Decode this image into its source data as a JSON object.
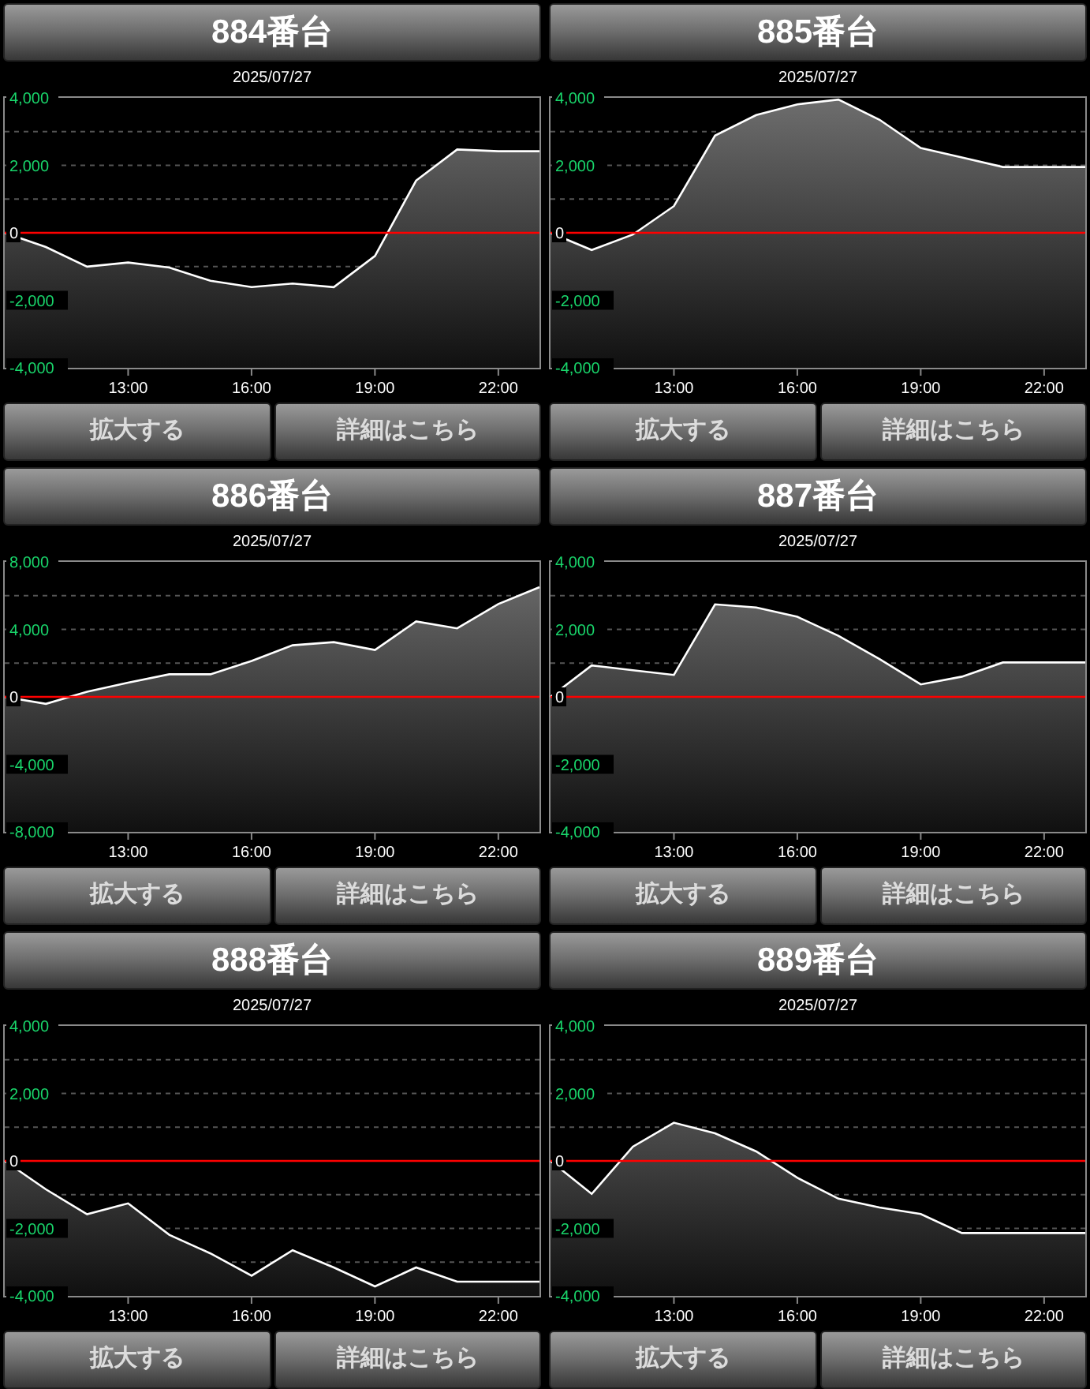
{
  "panels": [
    {
      "title": "884番台",
      "buttons": [
        "拡大する",
        "詳細はこちら"
      ],
      "chart_data": {
        "type": "line",
        "title": "2025/07/27",
        "x": [
          10,
          11,
          12,
          13,
          14,
          15,
          16,
          17,
          18,
          19,
          20,
          21,
          22,
          23
        ],
        "xlim": [
          10,
          23
        ],
        "ylim": [
          -4000,
          4000
        ],
        "xticks": [
          {
            "value": 13,
            "label": "13:00"
          },
          {
            "value": 16,
            "label": "16:00"
          },
          {
            "value": 19,
            "label": "19:00"
          },
          {
            "value": 22,
            "label": "22:00"
          }
        ],
        "yticks": [
          {
            "value": 4000,
            "label": "4,000"
          },
          {
            "value": 2000,
            "label": "2,000"
          },
          {
            "value": 0,
            "label": "0"
          },
          {
            "value": -2000,
            "label": "-2,000"
          },
          {
            "value": -4000,
            "label": "-4,000"
          }
        ],
        "series": [
          {
            "color": "#ffffff",
            "values": [
              0,
              -420,
              -1000,
              -880,
              -1030,
              -1420,
              -1610,
              -1500,
              -1610,
              -690,
              1550,
              2470,
              2420,
              2420
            ]
          }
        ],
        "ref_lines": [
          {
            "axis": "y",
            "value": 0
          }
        ]
      }
    },
    {
      "title": "885番台",
      "buttons": [
        "拡大する",
        "詳細はこちら"
      ],
      "chart_data": {
        "type": "line",
        "title": "2025/07/27",
        "x": [
          10,
          11,
          12,
          13,
          14,
          15,
          16,
          17,
          18,
          19,
          20,
          21,
          22,
          23
        ],
        "xlim": [
          10,
          23
        ],
        "ylim": [
          -4000,
          4000
        ],
        "xticks": [
          {
            "value": 13,
            "label": "13:00"
          },
          {
            "value": 16,
            "label": "16:00"
          },
          {
            "value": 19,
            "label": "19:00"
          },
          {
            "value": 22,
            "label": "22:00"
          }
        ],
        "yticks": [
          {
            "value": 4000,
            "label": "4,000"
          },
          {
            "value": 2000,
            "label": "2,000"
          },
          {
            "value": 0,
            "label": "0"
          },
          {
            "value": -2000,
            "label": "-2,000"
          },
          {
            "value": -4000,
            "label": "-4,000"
          }
        ],
        "series": [
          {
            "color": "#ffffff",
            "values": [
              0,
              -510,
              -50,
              790,
              2880,
              3490,
              3810,
              3950,
              3350,
              2510,
              2230,
              1950,
              1950,
              1950
            ]
          }
        ],
        "ref_lines": [
          {
            "axis": "y",
            "value": 0
          }
        ]
      }
    },
    {
      "title": "886番台",
      "buttons": [
        "拡大する",
        "詳細はこちら"
      ],
      "chart_data": {
        "type": "line",
        "title": "2025/07/27",
        "x": [
          10,
          11,
          12,
          13,
          14,
          15,
          16,
          17,
          18,
          19,
          20,
          21,
          22,
          23
        ],
        "xlim": [
          10,
          23
        ],
        "ylim": [
          -8000,
          8000
        ],
        "xticks": [
          {
            "value": 13,
            "label": "13:00"
          },
          {
            "value": 16,
            "label": "16:00"
          },
          {
            "value": 19,
            "label": "19:00"
          },
          {
            "value": 22,
            "label": "22:00"
          }
        ],
        "yticks": [
          {
            "value": 8000,
            "label": "8,000"
          },
          {
            "value": 4000,
            "label": "4,000"
          },
          {
            "value": 0,
            "label": "0"
          },
          {
            "value": -4000,
            "label": "-4,000"
          },
          {
            "value": -8000,
            "label": "-8,000"
          }
        ],
        "series": [
          {
            "color": "#ffffff",
            "values": [
              0,
              -410,
              310,
              840,
              1340,
              1340,
              2130,
              3060,
              3250,
              2780,
              4470,
              4060,
              5500,
              6500
            ]
          }
        ],
        "ref_lines": [
          {
            "axis": "y",
            "value": 0
          }
        ]
      }
    },
    {
      "title": "887番台",
      "buttons": [
        "拡大する",
        "詳細はこちら"
      ],
      "chart_data": {
        "type": "line",
        "title": "2025/07/27",
        "x": [
          10,
          11,
          12,
          13,
          14,
          15,
          16,
          17,
          18,
          19,
          20,
          21,
          22,
          23
        ],
        "xlim": [
          10,
          23
        ],
        "ylim": [
          -4000,
          4000
        ],
        "xticks": [
          {
            "value": 13,
            "label": "13:00"
          },
          {
            "value": 16,
            "label": "16:00"
          },
          {
            "value": 19,
            "label": "19:00"
          },
          {
            "value": 22,
            "label": "22:00"
          }
        ],
        "yticks": [
          {
            "value": 4000,
            "label": "4,000"
          },
          {
            "value": 2000,
            "label": "2,000"
          },
          {
            "value": 0,
            "label": "0"
          },
          {
            "value": -2000,
            "label": "-2,000"
          },
          {
            "value": -4000,
            "label": "-4,000"
          }
        ],
        "series": [
          {
            "color": "#ffffff",
            "values": [
              0,
              930,
              790,
              650,
              2740,
              2650,
              2370,
              1810,
              1120,
              370,
              600,
              1020,
              1020,
              1020
            ]
          }
        ],
        "ref_lines": [
          {
            "axis": "y",
            "value": 0
          }
        ]
      }
    },
    {
      "title": "888番台",
      "buttons": [
        "拡大する",
        "詳細はこちら"
      ],
      "chart_data": {
        "type": "line",
        "title": "2025/07/27",
        "x": [
          10,
          11,
          12,
          13,
          14,
          15,
          16,
          17,
          18,
          19,
          20,
          21,
          22,
          23
        ],
        "xlim": [
          10,
          23
        ],
        "ylim": [
          -4000,
          4000
        ],
        "xticks": [
          {
            "value": 13,
            "label": "13:00"
          },
          {
            "value": 16,
            "label": "16:00"
          },
          {
            "value": 19,
            "label": "19:00"
          },
          {
            "value": 22,
            "label": "22:00"
          }
        ],
        "yticks": [
          {
            "value": 4000,
            "label": "4,000"
          },
          {
            "value": 2000,
            "label": "2,000"
          },
          {
            "value": 0,
            "label": "0"
          },
          {
            "value": -2000,
            "label": "-2,000"
          },
          {
            "value": -4000,
            "label": "-4,000"
          }
        ],
        "series": [
          {
            "color": "#ffffff",
            "values": [
              0,
              -840,
              -1580,
              -1260,
              -2190,
              -2740,
              -3400,
              -2650,
              -3160,
              -3720,
              -3160,
              -3580,
              -3580,
              -3580
            ]
          }
        ],
        "ref_lines": [
          {
            "axis": "y",
            "value": 0
          }
        ]
      }
    },
    {
      "title": "889番台",
      "buttons": [
        "拡大する",
        "詳細はこちら"
      ],
      "chart_data": {
        "type": "line",
        "title": "2025/07/27",
        "x": [
          10,
          11,
          12,
          13,
          14,
          15,
          16,
          17,
          18,
          19,
          20,
          21,
          22,
          23
        ],
        "xlim": [
          10,
          23
        ],
        "ylim": [
          -4000,
          4000
        ],
        "xticks": [
          {
            "value": 13,
            "label": "13:00"
          },
          {
            "value": 16,
            "label": "16:00"
          },
          {
            "value": 19,
            "label": "19:00"
          },
          {
            "value": 22,
            "label": "22:00"
          }
        ],
        "yticks": [
          {
            "value": 4000,
            "label": "4,000"
          },
          {
            "value": 2000,
            "label": "2,000"
          },
          {
            "value": 0,
            "label": "0"
          },
          {
            "value": -2000,
            "label": "-2,000"
          },
          {
            "value": -4000,
            "label": "-4,000"
          }
        ],
        "series": [
          {
            "color": "#ffffff",
            "values": [
              0,
              -980,
              420,
              1130,
              820,
              280,
              -500,
              -1120,
              -1380,
              -1570,
              -2140,
              -2140,
              -2140,
              -2140
            ]
          }
        ],
        "ref_lines": [
          {
            "axis": "y",
            "value": 0
          }
        ]
      }
    }
  ]
}
